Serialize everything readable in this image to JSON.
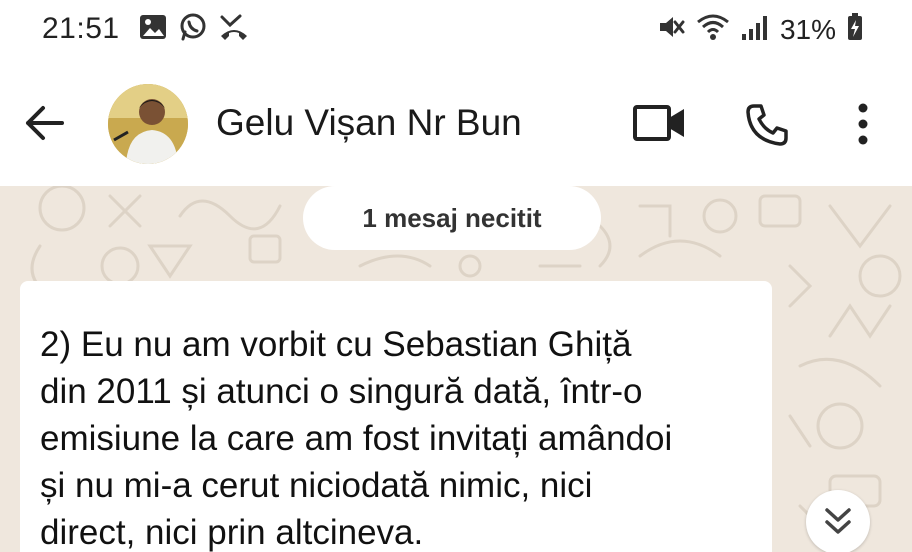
{
  "status_bar": {
    "time": "21:51",
    "battery_percent": "31%",
    "left_icons": [
      "gallery-icon",
      "whatsapp-icon",
      "missed-call-icon"
    ],
    "right_icons": [
      "mute-icon",
      "wifi-icon",
      "signal-icon",
      "battery-charging-icon"
    ]
  },
  "header": {
    "contact_name": "Gelu Vișan Nr Bun",
    "icons": [
      "back-arrow-icon",
      "video-call-icon",
      "phone-icon",
      "more-options-icon"
    ]
  },
  "chat": {
    "unread_label": "1 mesaj necitit",
    "message": "  2) Eu nu am vorbit cu Sebastian Ghiță\ndin 2011 și atunci o singură dată, într-o\nemisiune la care am fost invitați amândoi\nși nu mi-a cerut niciodată nimic, nici\ndirect, nici prin altcineva.",
    "scroll_icon": "double-chevron-down-icon"
  },
  "colors": {
    "chat_background": "#efe7dd",
    "bubble": "#ffffff",
    "icon": "#222222"
  }
}
